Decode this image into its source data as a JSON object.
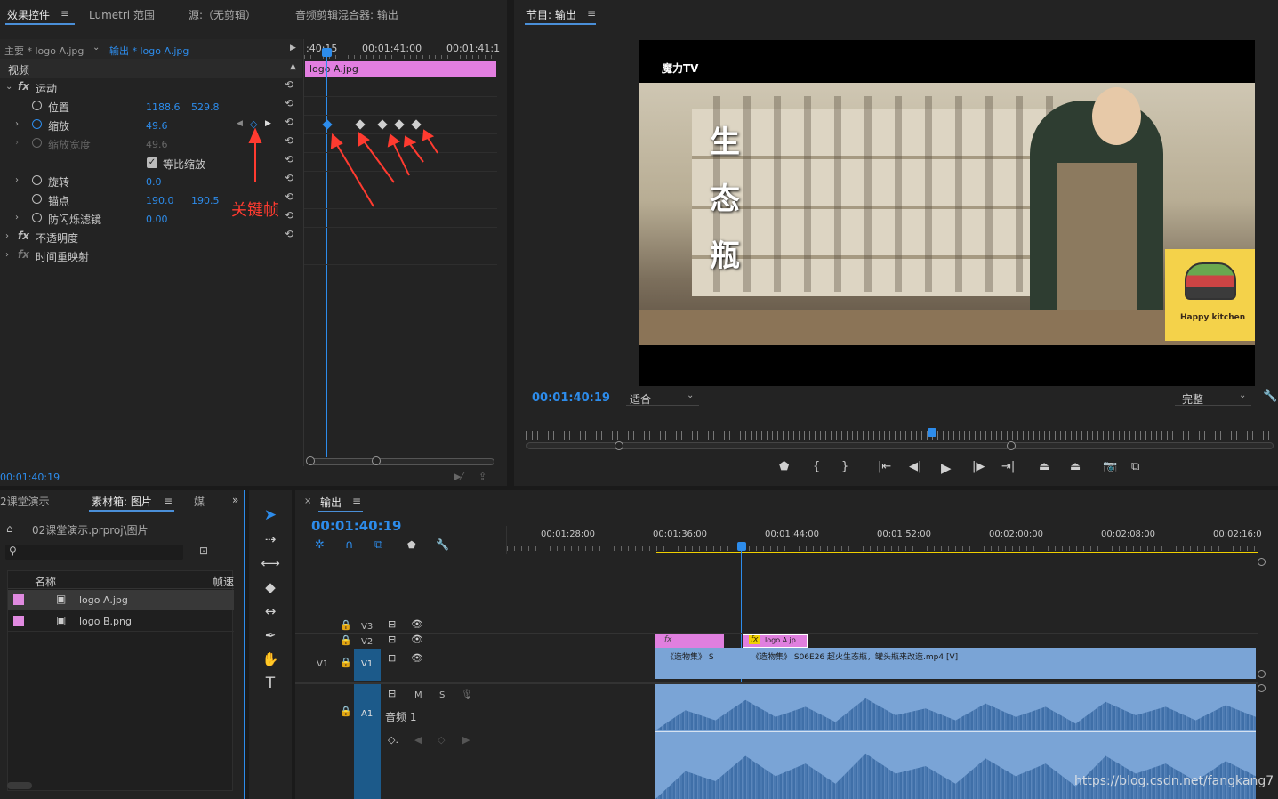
{
  "effect_panel": {
    "tabs": [
      "效果控件",
      "Lumetri 范围",
      "源:（无剪辑）",
      "音频剪辑混合器: 输出"
    ],
    "menu_icon": "hamburger-icon",
    "master_label": "主要 * logo A.jpg",
    "sequence_label": "输出 * logo A.jpg",
    "section_video": "视频",
    "timecodes": [
      ":40:15",
      "00:01:41:00",
      "00:01:41:1"
    ],
    "clip_name": "logo A.jpg",
    "current_time": "00:01:40:19",
    "properties": [
      {
        "label": "运动",
        "fx": true
      },
      {
        "label": "位置",
        "v1": "1188.6",
        "v2": "529.8"
      },
      {
        "label": "缩放",
        "v1": "49.6"
      },
      {
        "label": "缩放宽度",
        "v1": "49.6",
        "disabled": true
      },
      {
        "label": "等比缩放"
      },
      {
        "label": "旋转",
        "v1": "0.0"
      },
      {
        "label": "锚点",
        "v1": "190.0",
        "v2": "190.5"
      },
      {
        "label": "防闪烁滤镜",
        "v1": "0.00"
      },
      {
        "label": "不透明度",
        "fx": true
      },
      {
        "label": "时间重映射",
        "fx": true
      }
    ],
    "annotation": "关键帧",
    "annotation_color": "#ff3b30"
  },
  "program_monitor": {
    "title": "节目: 输出",
    "timecode": "00:01:40:19",
    "fit_option": "适合",
    "quality_option": "完整",
    "video": {
      "channel_label": "魔力TV",
      "vertical_text": [
        "生",
        "态",
        "瓶"
      ],
      "logo_text": "Happy kitchen"
    }
  },
  "project_panel": {
    "tabs": [
      "2课堂演示",
      "素材箱: 图片",
      "媒"
    ],
    "path": "02课堂演示.prproj\\图片",
    "search_placeholder": "",
    "columns": [
      "名称",
      "帧速"
    ],
    "items": [
      {
        "name": "logo A.jpg",
        "color": "#e08ae0"
      },
      {
        "name": "logo B.png",
        "color": "#e08ae0"
      }
    ]
  },
  "timeline": {
    "title": "输出",
    "timecode": "00:01:40:19",
    "ruler": [
      "00:01:28:00",
      "00:01:36:00",
      "00:01:44:00",
      "00:01:52:00",
      "00:02:00:00",
      "00:02:08:00",
      "00:02:16:0"
    ],
    "tracks": {
      "v3": "V3",
      "v2": "V2",
      "v1_src": "V1",
      "v1": "V1",
      "a1": "A1",
      "audio_label": "音频 1",
      "m": "M",
      "s": "S"
    },
    "clips": {
      "v2_a": "fx",
      "v2_b": "logo A.jp",
      "v1_a": "《造物集》 S",
      "v1_b": "《造物集》 S06E26 超火生态瓶，罐头瓶来改造.mp4 [V]"
    }
  },
  "watermark": "https://blog.csdn.net/fangkang7"
}
